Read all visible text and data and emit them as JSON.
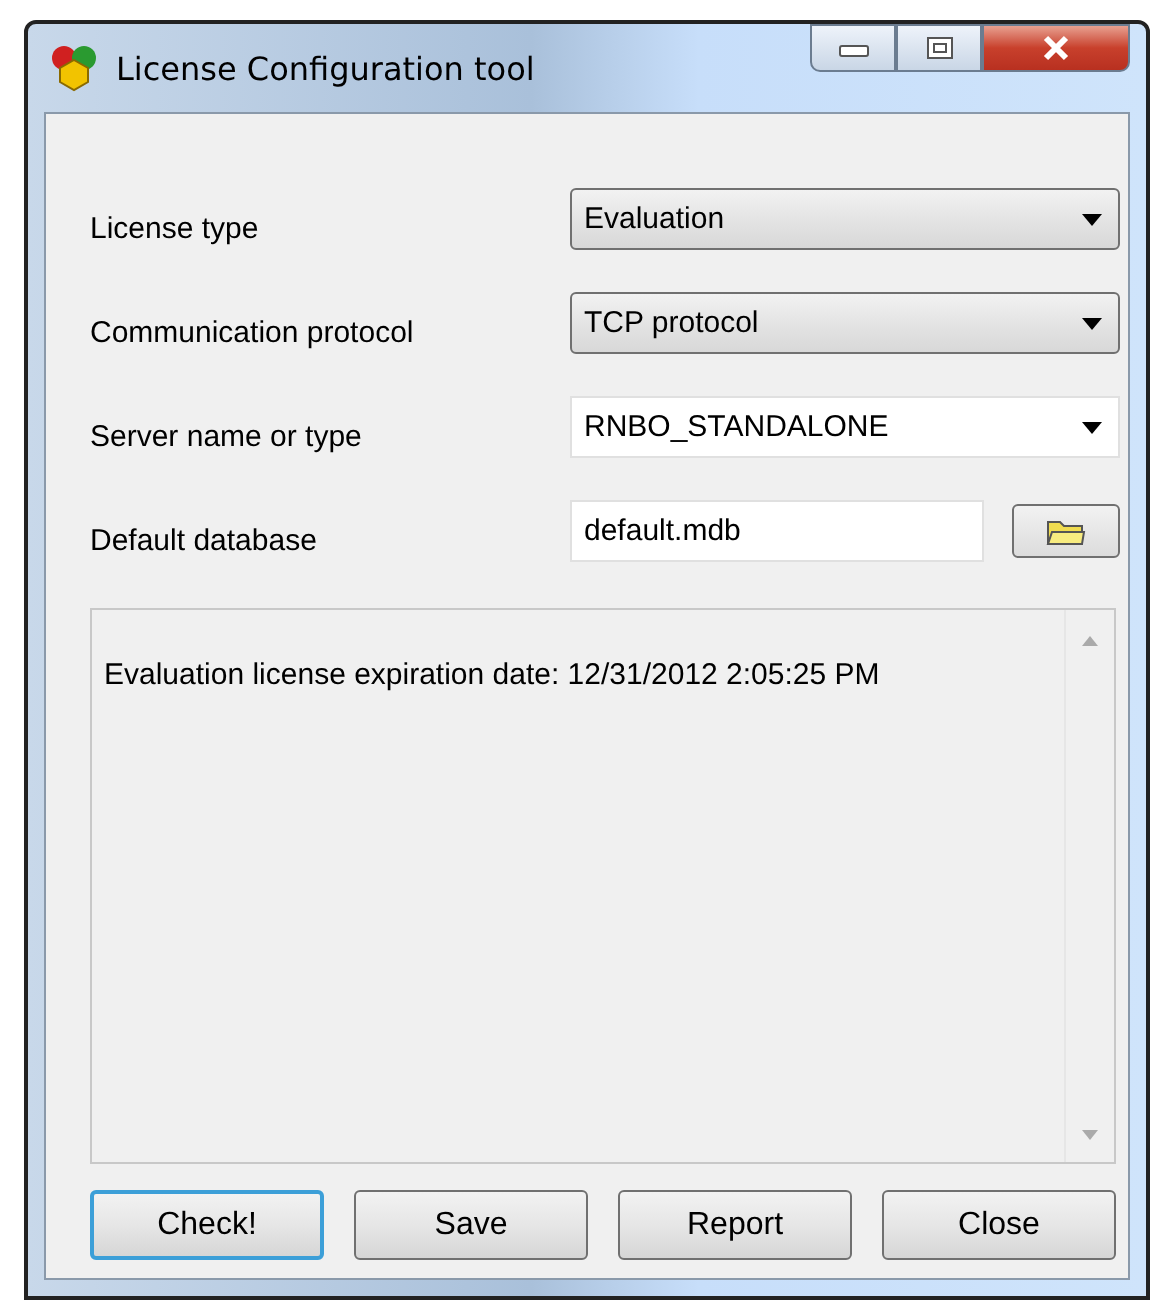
{
  "window": {
    "title": "License Configuration tool"
  },
  "fields": [
    {
      "label": "License type",
      "kind": "dropdown",
      "value": "Evaluation"
    },
    {
      "label": "Communication protocol",
      "kind": "dropdown",
      "value": "TCP protocol"
    },
    {
      "label": "Server name or type",
      "kind": "combo",
      "value": "RNBO_STANDALONE"
    },
    {
      "label": "Default database",
      "kind": "browse",
      "value": "default.mdb"
    }
  ],
  "log": {
    "text": "Evaluation license expiration date: 12/31/2012 2:05:25 PM"
  },
  "buttons": [
    {
      "label": "Check!",
      "default": true
    },
    {
      "label": "Save",
      "default": false
    },
    {
      "label": "Report",
      "default": false
    },
    {
      "label": "Close",
      "default": false
    }
  ]
}
